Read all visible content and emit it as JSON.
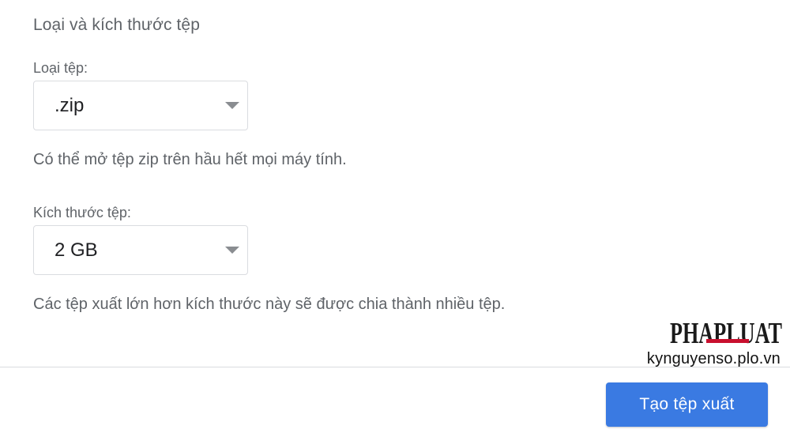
{
  "section": {
    "title": "Loại và kích thước tệp"
  },
  "file_type": {
    "label": "Loại tệp:",
    "value": ".zip",
    "help": "Có thể mở tệp zip trên hầu hết mọi máy tính."
  },
  "file_size": {
    "label": "Kích thước tệp:",
    "value": "2 GB",
    "help": "Các tệp xuất lớn hơn kích thước này sẽ được chia thành nhiều tệp."
  },
  "actions": {
    "create_export": "Tạo tệp xuất"
  },
  "watermark": {
    "logo_text": "PHAPLUAT",
    "site": "kynguyenso.plo.vn"
  },
  "colors": {
    "primary_button": "#3a7ae2",
    "logo_accent": "#c8102e"
  }
}
